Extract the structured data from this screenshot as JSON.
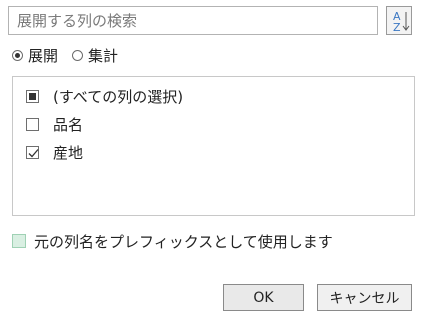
{
  "search": {
    "placeholder": "展開する列の検索",
    "value": ""
  },
  "sort_button": {
    "icon": "sort-az-icon",
    "glyph_top": "A",
    "glyph_bottom": "Z"
  },
  "mode": {
    "options": [
      {
        "label": "展開",
        "selected": true
      },
      {
        "label": "集計",
        "selected": false
      }
    ]
  },
  "columns": {
    "items": [
      {
        "label": "(すべての列の選択)",
        "state": "indeterminate"
      },
      {
        "label": "品名",
        "state": "unchecked"
      },
      {
        "label": "産地",
        "state": "checked"
      }
    ]
  },
  "prefix_option": {
    "label": "元の列名をプレフィックスとして使用します",
    "checked": false
  },
  "buttons": {
    "ok_label": "OK",
    "cancel_label": "キャンセル"
  },
  "colors": {
    "border": "#b3b3b3",
    "prefix_box_fill": "#d9efe2",
    "sort_icon_blue": "#3c78c3"
  }
}
